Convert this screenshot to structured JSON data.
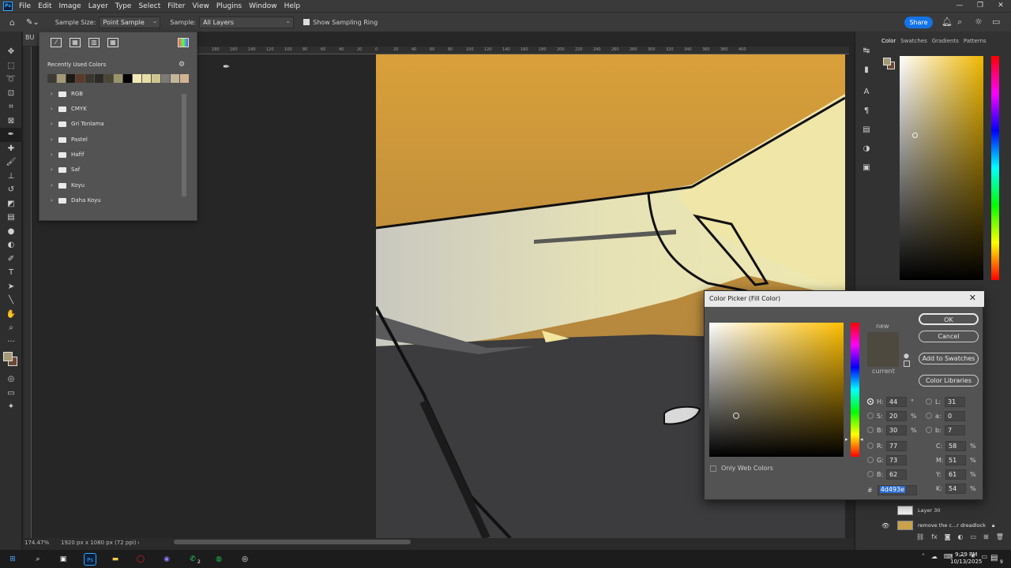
{
  "menubar": {
    "items": [
      "File",
      "Edit",
      "Image",
      "Layer",
      "Type",
      "Select",
      "Filter",
      "View",
      "Plugins",
      "Window",
      "Help"
    ]
  },
  "options": {
    "sample_size_label": "Sample Size:",
    "sample_size_value": "Point Sample",
    "sample_label": "Sample:",
    "sample_value": "All Layers",
    "sampling_ring_label": "Show Sampling Ring",
    "share_label": "Share"
  },
  "document": {
    "tab_label": "BU",
    "zoom": "174.47%",
    "doc_size": "1920 px x 1080 px (72 ppi)",
    "ruler_ticks": [
      "180",
      "160",
      "140",
      "120",
      "100",
      "80",
      "60",
      "40",
      "20",
      "0",
      "20",
      "40",
      "60",
      "80",
      "100",
      "120",
      "140",
      "160",
      "180",
      "200",
      "220",
      "240",
      "260",
      "280",
      "300",
      "320",
      "340",
      "360",
      "380",
      "400"
    ]
  },
  "swatches_popup": {
    "recent_label": "Recently Used Colors",
    "recent_colors": [
      "#3c3b35",
      "#a49a78",
      "#1e1b16",
      "#5b3a2b",
      "#3b3630",
      "#2c2a24",
      "#4a4636",
      "#9a946c",
      "#000000",
      "#f3e9b6",
      "#e8dfa8",
      "#cfc790",
      "#7b7a76",
      "#c3b79a",
      "#d2b392"
    ],
    "folders": [
      "RGB",
      "CMYK",
      "Gri Tonlama",
      "Pastel",
      "Hafif",
      "Saf",
      "Koyu",
      "Daha Koyu"
    ]
  },
  "color_panel": {
    "tabs": [
      "Color",
      "Swatches",
      "Gradients",
      "Patterns"
    ],
    "fg_color": "#a49a78",
    "bg_color": "#6b4a32"
  },
  "layers": {
    "rows": [
      "Layer 30",
      "remove the c...r dreadlock"
    ]
  },
  "color_picker": {
    "title": "Color Picker (Fill Color)",
    "new_label": "new",
    "current_label": "current",
    "new_color": "#4d493e",
    "current_color": "#4d493e",
    "buttons": [
      "OK",
      "Cancel",
      "Add to Swatches",
      "Color Libraries"
    ],
    "only_web_colors": "Only Web Colors",
    "hsb": [
      {
        "label": "H:",
        "value": "44",
        "unit": "°"
      },
      {
        "label": "S:",
        "value": "20",
        "unit": "%"
      },
      {
        "label": "B:",
        "value": "30",
        "unit": "%"
      }
    ],
    "rgb": [
      {
        "label": "R:",
        "value": "77"
      },
      {
        "label": "G:",
        "value": "73"
      },
      {
        "label": "B:",
        "value": "62"
      }
    ],
    "lab": [
      {
        "label": "L:",
        "value": "31"
      },
      {
        "label": "a:",
        "value": "0"
      },
      {
        "label": "b:",
        "value": "7"
      }
    ],
    "cmyk": [
      {
        "label": "C:",
        "value": "58",
        "unit": "%"
      },
      {
        "label": "M:",
        "value": "51",
        "unit": "%"
      },
      {
        "label": "Y:",
        "value": "61",
        "unit": "%"
      },
      {
        "label": "K:",
        "value": "54",
        "unit": "%"
      }
    ],
    "hex_label": "#",
    "hex_value": "4d493e"
  },
  "taskbar": {
    "time": "9:29 PM",
    "date": "10/13/2025",
    "notif_count": "9",
    "whatsapp_badge": "2"
  }
}
